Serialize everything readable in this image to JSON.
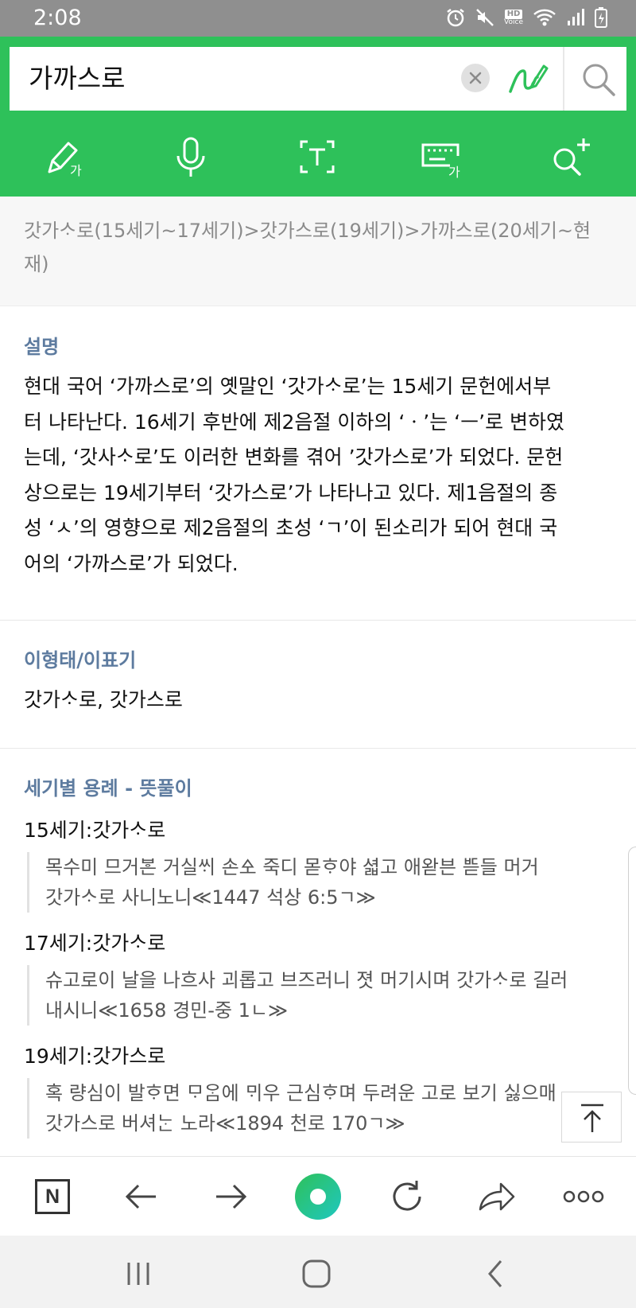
{
  "status": {
    "time": "2:08",
    "hd_label": "HD",
    "voice_label": "Voice"
  },
  "search": {
    "query": "가까스로"
  },
  "etymology": "갓가ᄉᆞ로(15세기~17세기)>갓가스로(19세기)>가까스로(20세기~현재)",
  "description": {
    "title": "설명",
    "lines": [
      "현대 국어 ‘가까스로’의 옛말인 ‘갓가ᄉᆞ로’는 15세기 문헌에서부",
      "터 나타난다. 16세기 후반에 제2음절 이하의 ‘ㆍ’는 ‘ㅡ’로 변하였",
      "는데, ‘갓사ᄉᆞ로’도 이러한 변화를 겪어 ’갓가스로’가 되었다. 문헌",
      "상으로는 19세기부터 ‘갓가스로’가 나타나고 있다. 제1음절의 종",
      "성 ‘ㅅ’의 영향으로 제2음절의 초성 ‘ㄱ’이 된소리가 되어 현대 국",
      "어의 ‘가까스로’가 되었다."
    ]
  },
  "variants": {
    "title": "이형태/이표기",
    "text": "갓가ᄉᆞ로, 갓가스로"
  },
  "usage": {
    "title": "세기별 용례 - 뜻풀이",
    "entries": [
      {
        "century": "15세기:갓가ᄉᆞ로",
        "line1": "목수미 므거ᄫᅳᆫ 거실ᄊᆡ 손ᅀᅩ 죽디 몯ᄒᆞ야 셟고 애왇븐 ᄠᅳᆮ들 머거",
        "line2": "갓가ᄉᆞ로 사니노니≪1447 석상 6:5ㄱ≫"
      },
      {
        "century": "17세기:갓가ᄉᆞ로",
        "line1": "슈고로이 날을 나흐사 괴롭고 브즈러니 졋 머기시며 갓가ᄉᆞ로 길러",
        "line2": "내시니≪1658 경민-중 1ㄴ≫"
      },
      {
        "century": "19세기:갓가스로",
        "line1": "혹 량심이 발ᄒᆞ면 ᄆᆞᄋᆞᆷ에 ᄆᆡ우 근심ᄒᆞ며 두려운 고로 보기 싫으매",
        "line2": "갓가스로 버셔ᄂᆞᆫ 노라≪1894 천로 170ㄱ≫"
      }
    ]
  },
  "browser": {
    "logo": "N"
  },
  "colors": {
    "brand_green": "#2ec15a",
    "section_title": "#5d7b9f",
    "status_bar": "#8f8f8f"
  }
}
